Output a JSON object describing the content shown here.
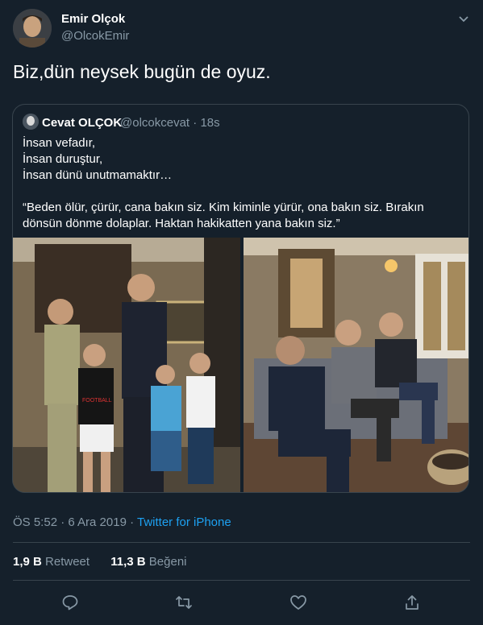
{
  "author": {
    "name": "Emir Olçok",
    "handle": "@OlcokEmir"
  },
  "tweet_text": "Biz,dün neysek bugün de oyuz.",
  "quoted": {
    "name": "Cevat OLÇOK",
    "handle": "@olcokcevat",
    "time": "18s",
    "lines": [
      "İnsan vefadır,",
      "İnsan duruştur,",
      "İnsan dünü unutmamaktır…"
    ],
    "quote": "“Beden ölür, çürür, cana bakın siz. Kim kiminle yürür, ona bakın siz. Bırakın dönsün dönme dolaplar. Haktan hakikatten yana bakın siz.”",
    "photo_text": {
      "shirt": "FOOTBALL"
    }
  },
  "meta": {
    "timestamp": "ÖS 5:52 · 6 Ara 2019 · ",
    "source": "Twitter for iPhone"
  },
  "stats": {
    "retweets": "1,9 B",
    "retweets_label": "Retweet",
    "likes": "11,3 B",
    "likes_label": "Beğeni"
  },
  "icons": [
    "reply-icon",
    "retweet-icon",
    "like-icon",
    "share-icon"
  ],
  "colors": {
    "background": "#15202b",
    "secondary_text": "#8899a6",
    "link": "#1da1f2",
    "border": "#38444d"
  }
}
